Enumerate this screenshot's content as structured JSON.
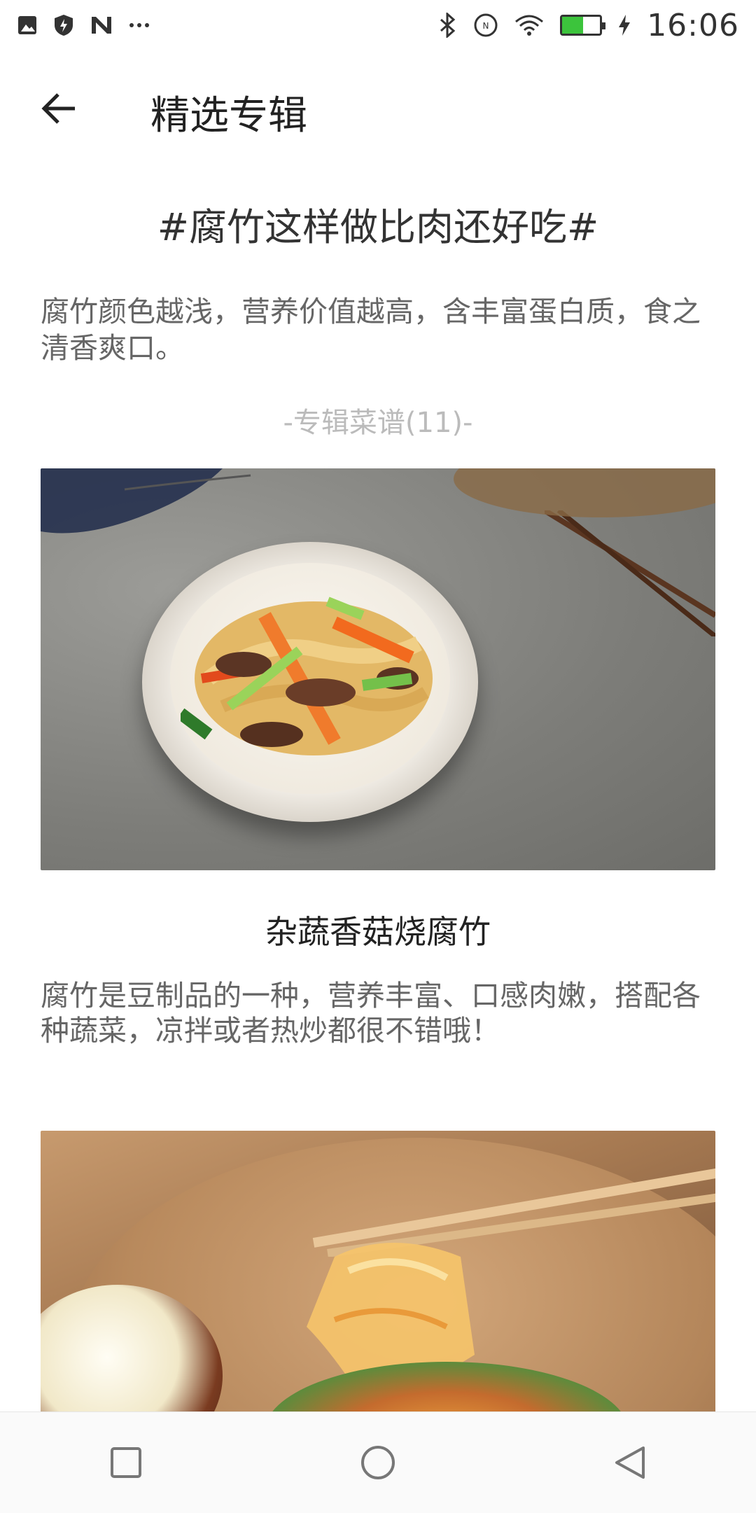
{
  "status_bar": {
    "time": "16:06",
    "left_icons": [
      "gallery-icon",
      "shield-bolt-icon",
      "n-icon",
      "more-icon"
    ],
    "right_icons": [
      "bluetooth-icon",
      "nfc-icon",
      "wifi-icon",
      "battery-icon",
      "charging-icon"
    ],
    "battery_level": 0.55,
    "battery_color": "#3cc43c"
  },
  "app_bar": {
    "title": "精选专辑",
    "back_icon": "arrow-left-icon"
  },
  "album": {
    "title": "#腐竹这样做比肉还好吃#",
    "description": "腐竹颜色越浅，营养价值越高，含丰富蛋白质，食之清香爽口。",
    "recipe_count_label": "-专辑菜谱(11)-"
  },
  "recipes": [
    {
      "title": "杂蔬香菇烧腐竹",
      "description": "腐竹是豆制品的一种，营养丰富、口感肉嫩，搭配各种蔬菜，凉拌或者热炒都很不错哦！"
    },
    {
      "title": "",
      "description": ""
    }
  ],
  "nav_bar": {
    "buttons": [
      "recents-icon",
      "home-icon",
      "back-icon"
    ]
  }
}
